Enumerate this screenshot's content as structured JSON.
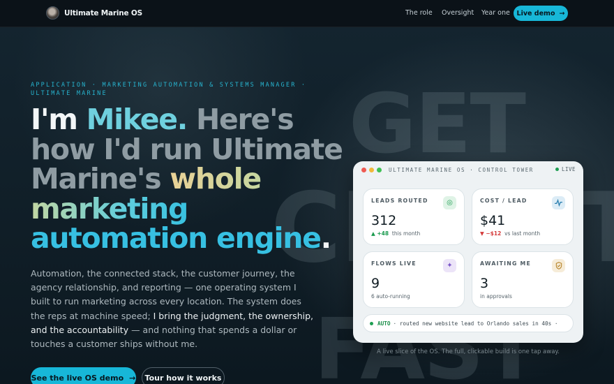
{
  "nav": {
    "brand": "Ultimate Marine OS",
    "links": [
      "The role",
      "Oversight",
      "Year one"
    ],
    "cta": "Live demo"
  },
  "background_words": [
    "GET",
    "CLIENTS",
    "FAST"
  ],
  "hero": {
    "eyebrow": "APPLICATION · MARKETING AUTOMATION & SYSTEMS MANAGER · ULTIMATE MARINE",
    "headline": {
      "part1": "I'm ",
      "name": "Mikee.",
      "part2": " Here's how I'd run Ultimate Marine's ",
      "grad1": "whole marketing",
      "grad2": "automation engine",
      "dot": "."
    },
    "body": {
      "p1": "Automation, the connected stack, the customer journey, the agency relationship, and reporting — one operating system I built to run marketing across every location. The system does the reps at machine speed; ",
      "highlight": "I bring the judgment, the ownership, and the accountability",
      "p2": " — and nothing that spends a dollar or touches a customer ships without me."
    },
    "primary_button": "See the live OS demo",
    "secondary_button": "Tour how it works"
  },
  "card": {
    "title": "ULTIMATE MARINE OS · CONTROL TOWER",
    "live": "LIVE",
    "metrics": [
      {
        "label": "LEADS ROUTED",
        "value": "312",
        "delta": "▲ +48",
        "note": "this month",
        "icon": "target-icon"
      },
      {
        "label": "COST / LEAD",
        "value": "$41",
        "delta": "▼ −$12",
        "note": "vs last month",
        "icon": "pulse-icon"
      },
      {
        "label": "FLOWS LIVE",
        "value": "9",
        "delta": "",
        "note": "6 auto-running",
        "icon": "sparkle-icon"
      },
      {
        "label": "AWAITING ME",
        "value": "3",
        "delta": "",
        "note": "in approvals",
        "icon": "shield-icon"
      }
    ],
    "ticker": {
      "tag": "AUTO",
      "text": "· routed new website lead to Orlando sales in 40s ·"
    }
  },
  "caption": "A live slice of the OS. The full, clickable build is one tap away.",
  "colors": {
    "accent": "#17b7d8",
    "up": "#1a9a4e",
    "down": "#d43a3a"
  }
}
